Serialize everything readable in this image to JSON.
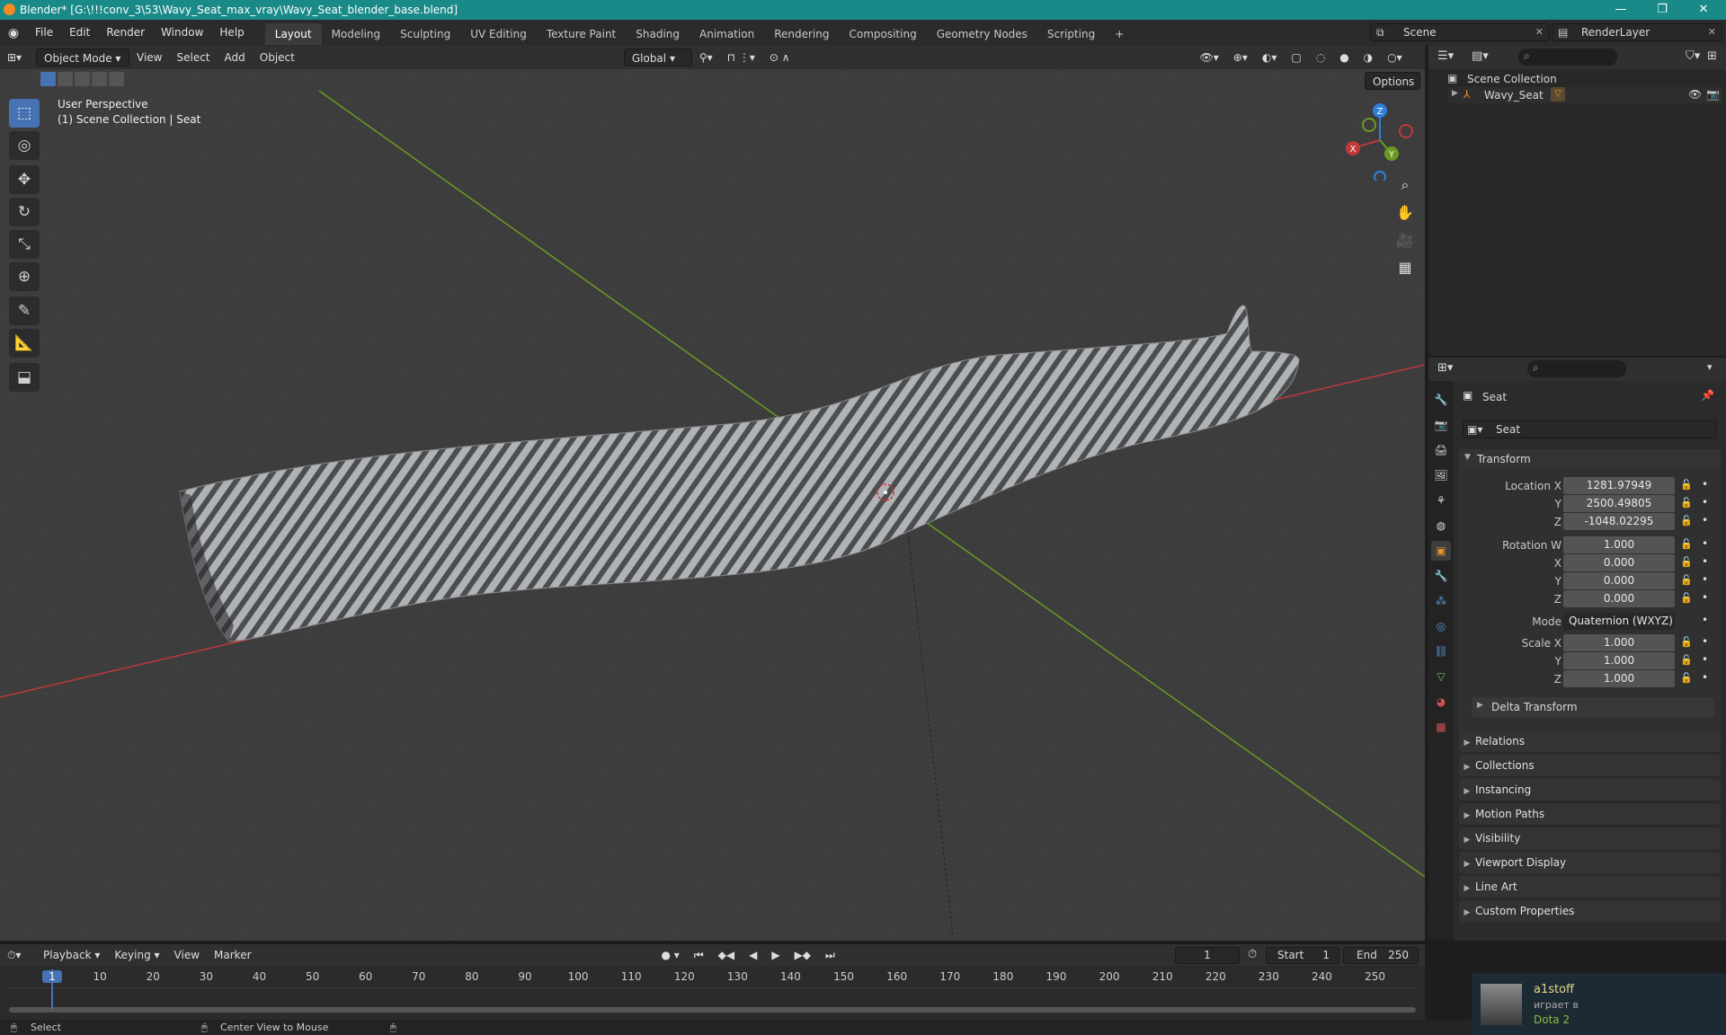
{
  "titlebar": {
    "title": "Blender* [G:\\!!!conv_3\\53\\Wavy_Seat_max_vray\\Wavy_Seat_blender_base.blend]",
    "minimize": "—",
    "maximize": "❐",
    "close": "✕"
  },
  "menu": {
    "items": [
      "File",
      "Edit",
      "Render",
      "Window",
      "Help"
    ]
  },
  "workspaces": {
    "tabs": [
      "Layout",
      "Modeling",
      "Sculpting",
      "UV Editing",
      "Texture Paint",
      "Shading",
      "Animation",
      "Rendering",
      "Compositing",
      "Geometry Nodes",
      "Scripting"
    ],
    "active": "Layout",
    "add": "+"
  },
  "scene": {
    "name": "Scene",
    "render_layer": "RenderLayer"
  },
  "viewport_header": {
    "mode": "Object Mode",
    "menus": [
      "View",
      "Select",
      "Add",
      "Object"
    ],
    "orientation": "Global",
    "options": "Options"
  },
  "viewport": {
    "perspective": "User Perspective",
    "collection_info": "(1) Scene Collection | Seat",
    "gizmo": {
      "z": "Z",
      "x": "X",
      "y": "Y"
    }
  },
  "outliner": {
    "root": "Scene Collection",
    "items": [
      {
        "name": "Wavy_Seat"
      }
    ]
  },
  "properties": {
    "object_name": "Seat",
    "datablock_name": "Seat",
    "transform_title": "Transform",
    "location": {
      "label_x": "Location X",
      "label_y": "Y",
      "label_z": "Z",
      "x": "1281.97949",
      "y": "2500.49805",
      "z": "-1048.02295"
    },
    "rotation": {
      "label_w": "Rotation W",
      "label_x": "X",
      "label_y": "Y",
      "label_z": "Z",
      "w": "1.000",
      "x": "0.000",
      "y": "0.000",
      "z": "0.000"
    },
    "mode_label": "Mode",
    "mode_value": "Quaternion (WXYZ)",
    "scale": {
      "label_x": "Scale X",
      "label_y": "Y",
      "label_z": "Z",
      "x": "1.000",
      "y": "1.000",
      "z": "1.000"
    },
    "delta_transform": "Delta Transform",
    "panels": [
      "Relations",
      "Collections",
      "Instancing",
      "Motion Paths",
      "Visibility",
      "Viewport Display",
      "Line Art",
      "Custom Properties"
    ]
  },
  "timeline": {
    "menus": [
      "Playback",
      "Keying",
      "View",
      "Marker"
    ],
    "current_frame": "1",
    "start_label": "Start",
    "start": "1",
    "end_label": "End",
    "end": "250",
    "ticks": [
      "1",
      "10",
      "20",
      "30",
      "40",
      "50",
      "60",
      "70",
      "80",
      "90",
      "100",
      "110",
      "120",
      "130",
      "140",
      "150",
      "160",
      "170",
      "180",
      "190",
      "200",
      "210",
      "220",
      "230",
      "240",
      "250"
    ]
  },
  "statusbar": {
    "select": "Select",
    "center": "Center View to Mouse"
  },
  "notification": {
    "user": "a1stoff",
    "status": "играет в",
    "game": "Dota 2"
  },
  "colors": {
    "title_bar": "#1a8a89",
    "accent": "#4772b3",
    "x_axis": "#c0393b",
    "y_axis": "#6a9a23",
    "z_axis": "#2f7fd8"
  }
}
